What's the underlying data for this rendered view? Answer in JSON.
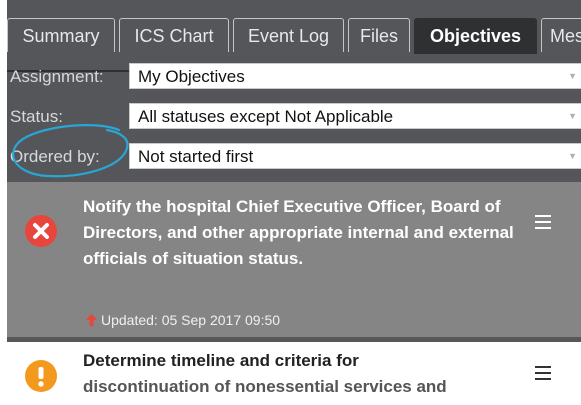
{
  "tabs": [
    {
      "label": "Summary",
      "active": false
    },
    {
      "label": "ICS Chart",
      "active": false
    },
    {
      "label": "Event Log",
      "active": false
    },
    {
      "label": "Files",
      "active": false
    },
    {
      "label": "Objectives",
      "active": true
    },
    {
      "label": "Mes",
      "active": false
    }
  ],
  "filters": {
    "assignment": {
      "label": "Assignment:",
      "value": "My Objectives"
    },
    "status": {
      "label": "Status:",
      "value": "All statuses except Not Applicable"
    },
    "ordered_by": {
      "label": "Ordered by:",
      "value": "Not started first"
    }
  },
  "objectives": [
    {
      "title": "Notify the hospital Chief Executive Officer, Board of Directors, and other appropriate internal and external officials of situation status.",
      "updated": "Updated: 05 Sep 2017 09:50",
      "status_icon": "not-started-x-icon",
      "priority_icon": "up-arrow-icon"
    },
    {
      "title_line1": "Determine timeline and criteria for",
      "title_line2": "discontinuation of nonessential services and",
      "status_icon": "warning-exclamation-icon"
    }
  ],
  "colors": {
    "toolbar_bg": "#545659",
    "active_tab_bg": "#2f3032",
    "selected_card_bg": "#858585",
    "error_red": "#e8453c",
    "warning_orange": "#f39a1e",
    "annotation_blue": "#2aa6d6"
  }
}
